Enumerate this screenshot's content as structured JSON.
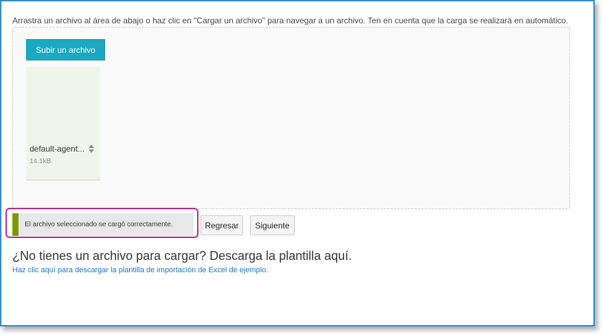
{
  "instructions": "Arrastra un archivo al área de abajo o haz clic en \"Cargar un archivo\" para navegar a un archivo. Ten en cuenta que la carga se realizará en automático.",
  "upload_button": "Subir un archivo",
  "file": {
    "name": "default-agent...",
    "size": "14.1kB"
  },
  "status_message": "El archivo seleccionado se cargó correctamente.",
  "buttons": {
    "back": "Regresar",
    "next": "Siguiente"
  },
  "template": {
    "heading": "¿No tienes un archivo para cargar? Descarga la plantilla aquí.",
    "link": "Haz clic aquí para descargar la plantilla de importación de Excel de ejemplo."
  },
  "colors": {
    "window_border": "#2a8ad4",
    "upload_button": "#1aa9c0",
    "file_card": "#f0f5ec",
    "status_bar": "#7a9a01",
    "highlight": "#c0268e",
    "link": "#1a73c9"
  },
  "icons": {
    "sort": "sort-icon"
  }
}
